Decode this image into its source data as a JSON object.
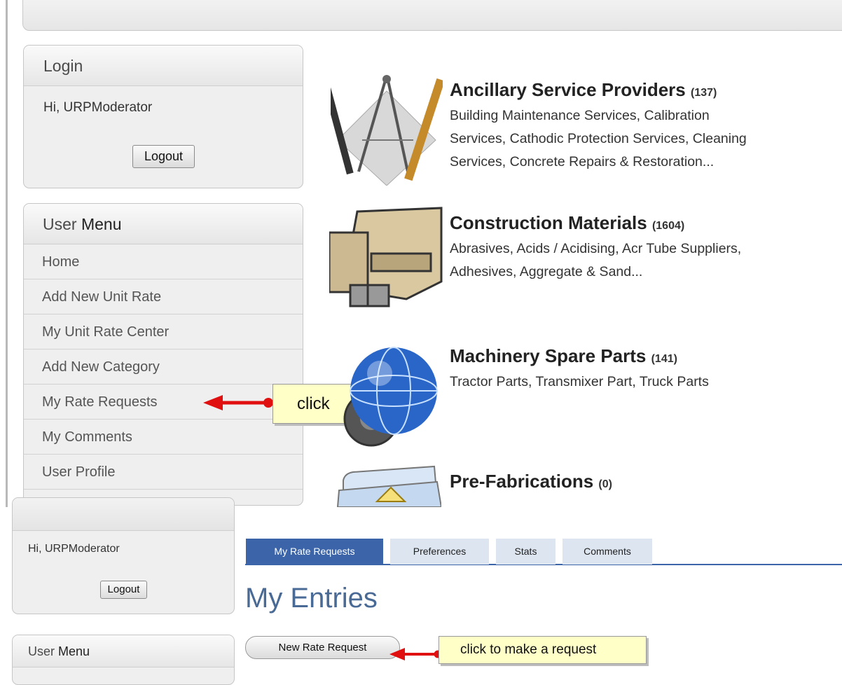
{
  "top": {
    "login": {
      "title": "Login",
      "greeting": "Hi, URPModerator",
      "logout_label": "Logout"
    },
    "user_menu": {
      "title_prefix": "User ",
      "title_suffix": "Menu",
      "items": [
        "Home",
        "Add New Unit Rate",
        "My Unit Rate Center",
        "Add New Category",
        "My Rate Requests",
        "My Comments",
        "User Profile"
      ]
    },
    "categories": [
      {
        "name": "Ancillary Service Providers",
        "count": "(137)",
        "desc_lines": [
          "Building Maintenance Services, Calibration",
          "Services, Cathodic Protection Services, Cleaning",
          "Services, Concrete Repairs & Restoration..."
        ]
      },
      {
        "name": "Construction Materials",
        "count": "(1604)",
        "desc_lines": [
          "Abrasives, Acids / Acidising, Acr Tube Suppliers,",
          "Adhesives, Aggregate & Sand..."
        ]
      },
      {
        "name": "Machinery Spare Parts",
        "count": "(141)",
        "desc_lines": [
          "Tractor Parts, Transmixer Part, Truck Parts"
        ]
      },
      {
        "name": "Pre-Fabrications",
        "count": "(0)",
        "desc_lines": []
      }
    ],
    "callout": "click"
  },
  "bottom": {
    "greeting": "Hi, URPModerator",
    "logout_label": "Logout",
    "user_menu_prefix": "User ",
    "user_menu_suffix": "Menu",
    "tabs": [
      "My Rate Requests",
      "Preferences",
      "Stats",
      "Comments"
    ],
    "page_title": "My Entries",
    "new_request_label": "New Rate Request",
    "callout": "click to make a request"
  },
  "colors": {
    "arrow": "#e01010",
    "callout_bg": "#ffffc8",
    "tab_active": "#3c64a8",
    "tab": "#dde6f0"
  },
  "icons": [
    "drafting-tools-icon",
    "steel-beams-icon",
    "globe-gear-icon",
    "folder-icon"
  ]
}
